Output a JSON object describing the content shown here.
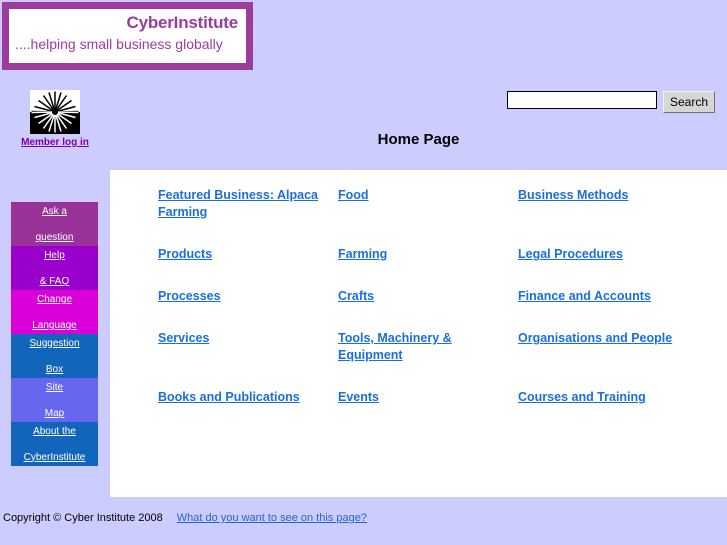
{
  "theme": {
    "page_background": "#ccccff",
    "masthead_border": "#9c3d9c",
    "brand_text_color": "#9c3d9c",
    "link_color": "#1a6fe0",
    "panel_background": "#ffffff"
  },
  "masthead": {
    "brand_name": "CyberInstitute",
    "tagline": "....helping small business globally"
  },
  "logo": {
    "icon_name": "starburst-logo",
    "member_login_label": "Member log in"
  },
  "search": {
    "value": "",
    "placeholder": "",
    "button_label": "Search"
  },
  "header": {
    "page_title": "Home Page"
  },
  "side_nav": {
    "items": [
      {
        "label_line1": "Ask a",
        "label_line2": "question",
        "color": "#993399"
      },
      {
        "label_line1": "Help",
        "label_line2": "& FAQ",
        "color": "#9900cc"
      },
      {
        "label_line1": "Change",
        "label_line2": "Language",
        "color": "#d900d9"
      },
      {
        "label_line1": "Suggestion",
        "label_line2": "Box",
        "color": "#1166bb"
      },
      {
        "label_line1": "Site",
        "label_line2": "Map",
        "color": "#6666ee"
      },
      {
        "label_line1": "About the",
        "label_line2": "CyberInstitute",
        "color": "#1166bb"
      }
    ]
  },
  "main": {
    "rows": [
      {
        "cells": [
          {
            "label": "Featured Business: Alpaca Farming"
          },
          {
            "label": "Food"
          },
          {
            "label": "Business Methods"
          }
        ]
      },
      {
        "cells": [
          {
            "label": "Products"
          },
          {
            "label": "Farming"
          },
          {
            "label": "Legal Procedures"
          }
        ]
      },
      {
        "cells": [
          {
            "label": "Processes"
          },
          {
            "label": "Crafts"
          },
          {
            "label": "Finance and Accounts"
          }
        ]
      },
      {
        "cells": [
          {
            "label": "Services"
          },
          {
            "label": "Tools, Machinery & Equipment"
          },
          {
            "label": "Organisations and People"
          }
        ]
      },
      {
        "cells": [
          {
            "label": "Books and Publications"
          },
          {
            "label": "Events"
          },
          {
            "label": "Courses and Training"
          }
        ]
      }
    ]
  },
  "footer": {
    "copyright": "Copyright © Cyber Institute 2008",
    "feedback_label": "What do you want to see on this page?"
  }
}
